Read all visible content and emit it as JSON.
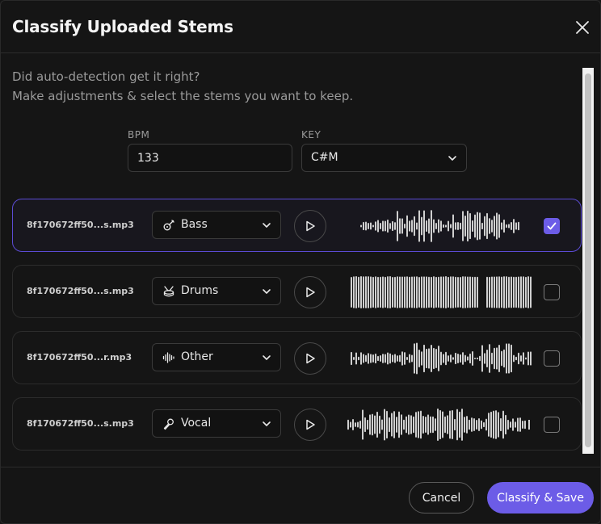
{
  "dialog": {
    "title": "Classify Uploaded Stems",
    "intro_line1": "Did auto-detection get it right?",
    "intro_line2": "Make adjustments & select the stems you want to keep."
  },
  "bpm": {
    "label": "BPM",
    "value": "133"
  },
  "key": {
    "label": "KEY",
    "value": "C#M"
  },
  "stems": [
    {
      "filename": "8f170672ff50...s.mp3",
      "type": "Bass",
      "type_icon": "guitar-icon",
      "checked": true
    },
    {
      "filename": "8f170672ff50...s.mp3",
      "type": "Drums",
      "type_icon": "drum-icon",
      "checked": false
    },
    {
      "filename": "8f170672ff50...r.mp3",
      "type": "Other",
      "type_icon": "waveform-icon",
      "checked": false
    },
    {
      "filename": "8f170672ff50...s.mp3",
      "type": "Vocal",
      "type_icon": "microphone-icon",
      "checked": false
    }
  ],
  "footer": {
    "cancel_label": "Cancel",
    "save_label": "Classify & Save"
  },
  "colors": {
    "accent": "#6c5ce7",
    "background": "#151515",
    "waveform": "#cfcfcf"
  }
}
